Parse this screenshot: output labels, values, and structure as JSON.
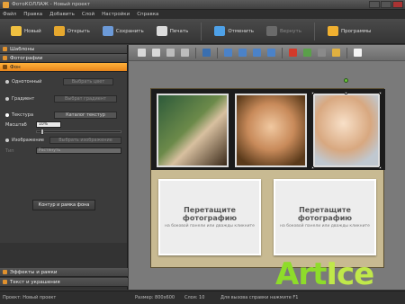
{
  "window": {
    "title": "ФотоКОЛЛАЖ - Новый проект"
  },
  "menu": [
    "Файл",
    "Правка",
    "Добавить",
    "Слой",
    "Настройки",
    "Справка"
  ],
  "toolbar": {
    "buttons": [
      {
        "label": "Новый",
        "icon": "new-icon",
        "color": "#f0c040"
      },
      {
        "label": "Открыть",
        "icon": "open-folder-icon",
        "color": "#e6a82e"
      },
      {
        "label": "Сохранить",
        "icon": "save-icon",
        "color": "#6c9ad8"
      },
      {
        "label": "Печать",
        "icon": "print-icon",
        "color": "#dcdcdc"
      },
      {
        "label": "Отменить",
        "icon": "undo-icon",
        "color": "#4ea1e8"
      },
      {
        "label": "Вернуть",
        "icon": "redo-icon",
        "color": "#6a6a6a"
      },
      {
        "label": "Программы",
        "icon": "programs-icon",
        "color": "#f0b030"
      }
    ]
  },
  "sidebar": {
    "sections": [
      {
        "label": "Шаблоны"
      },
      {
        "label": "Фотографии"
      },
      {
        "label": "Фон",
        "active": true
      }
    ],
    "fon": {
      "solid_label": "Однотонный",
      "pick_color_label": "Выбрать цвет",
      "gradient_label": "Градиент",
      "pick_gradient_label": "Выбрат градиент",
      "texture_label": "Текстура",
      "texture_catalog_label": "Каталог текстур",
      "scale_label": "Масштаб",
      "scale_value": "10%",
      "image_label": "Изображение",
      "pick_image_label": "Выбрать изображение",
      "type_label": "Тип",
      "type_value": "Растянуть",
      "contour_button_label": "Контур и рамка фона"
    },
    "bottom_sections": [
      {
        "label": "Эффекты и рамки"
      },
      {
        "label": "Текст и украшения"
      }
    ]
  },
  "canvas": {
    "placeholder_title": "Перетащите фотографию",
    "placeholder_sub": "на боковой панели или дважды кликните"
  },
  "status": {
    "project": "Проект: Новый проект",
    "size": "Размер: 800x600",
    "layer": "Слоя: 10",
    "help": "Для вызова справки нажмите F1"
  },
  "watermark": {
    "part1": "Art",
    "part2": "Ice"
  },
  "colors": {
    "accent": "#f0a030",
    "watermark": "#8edc2a"
  }
}
